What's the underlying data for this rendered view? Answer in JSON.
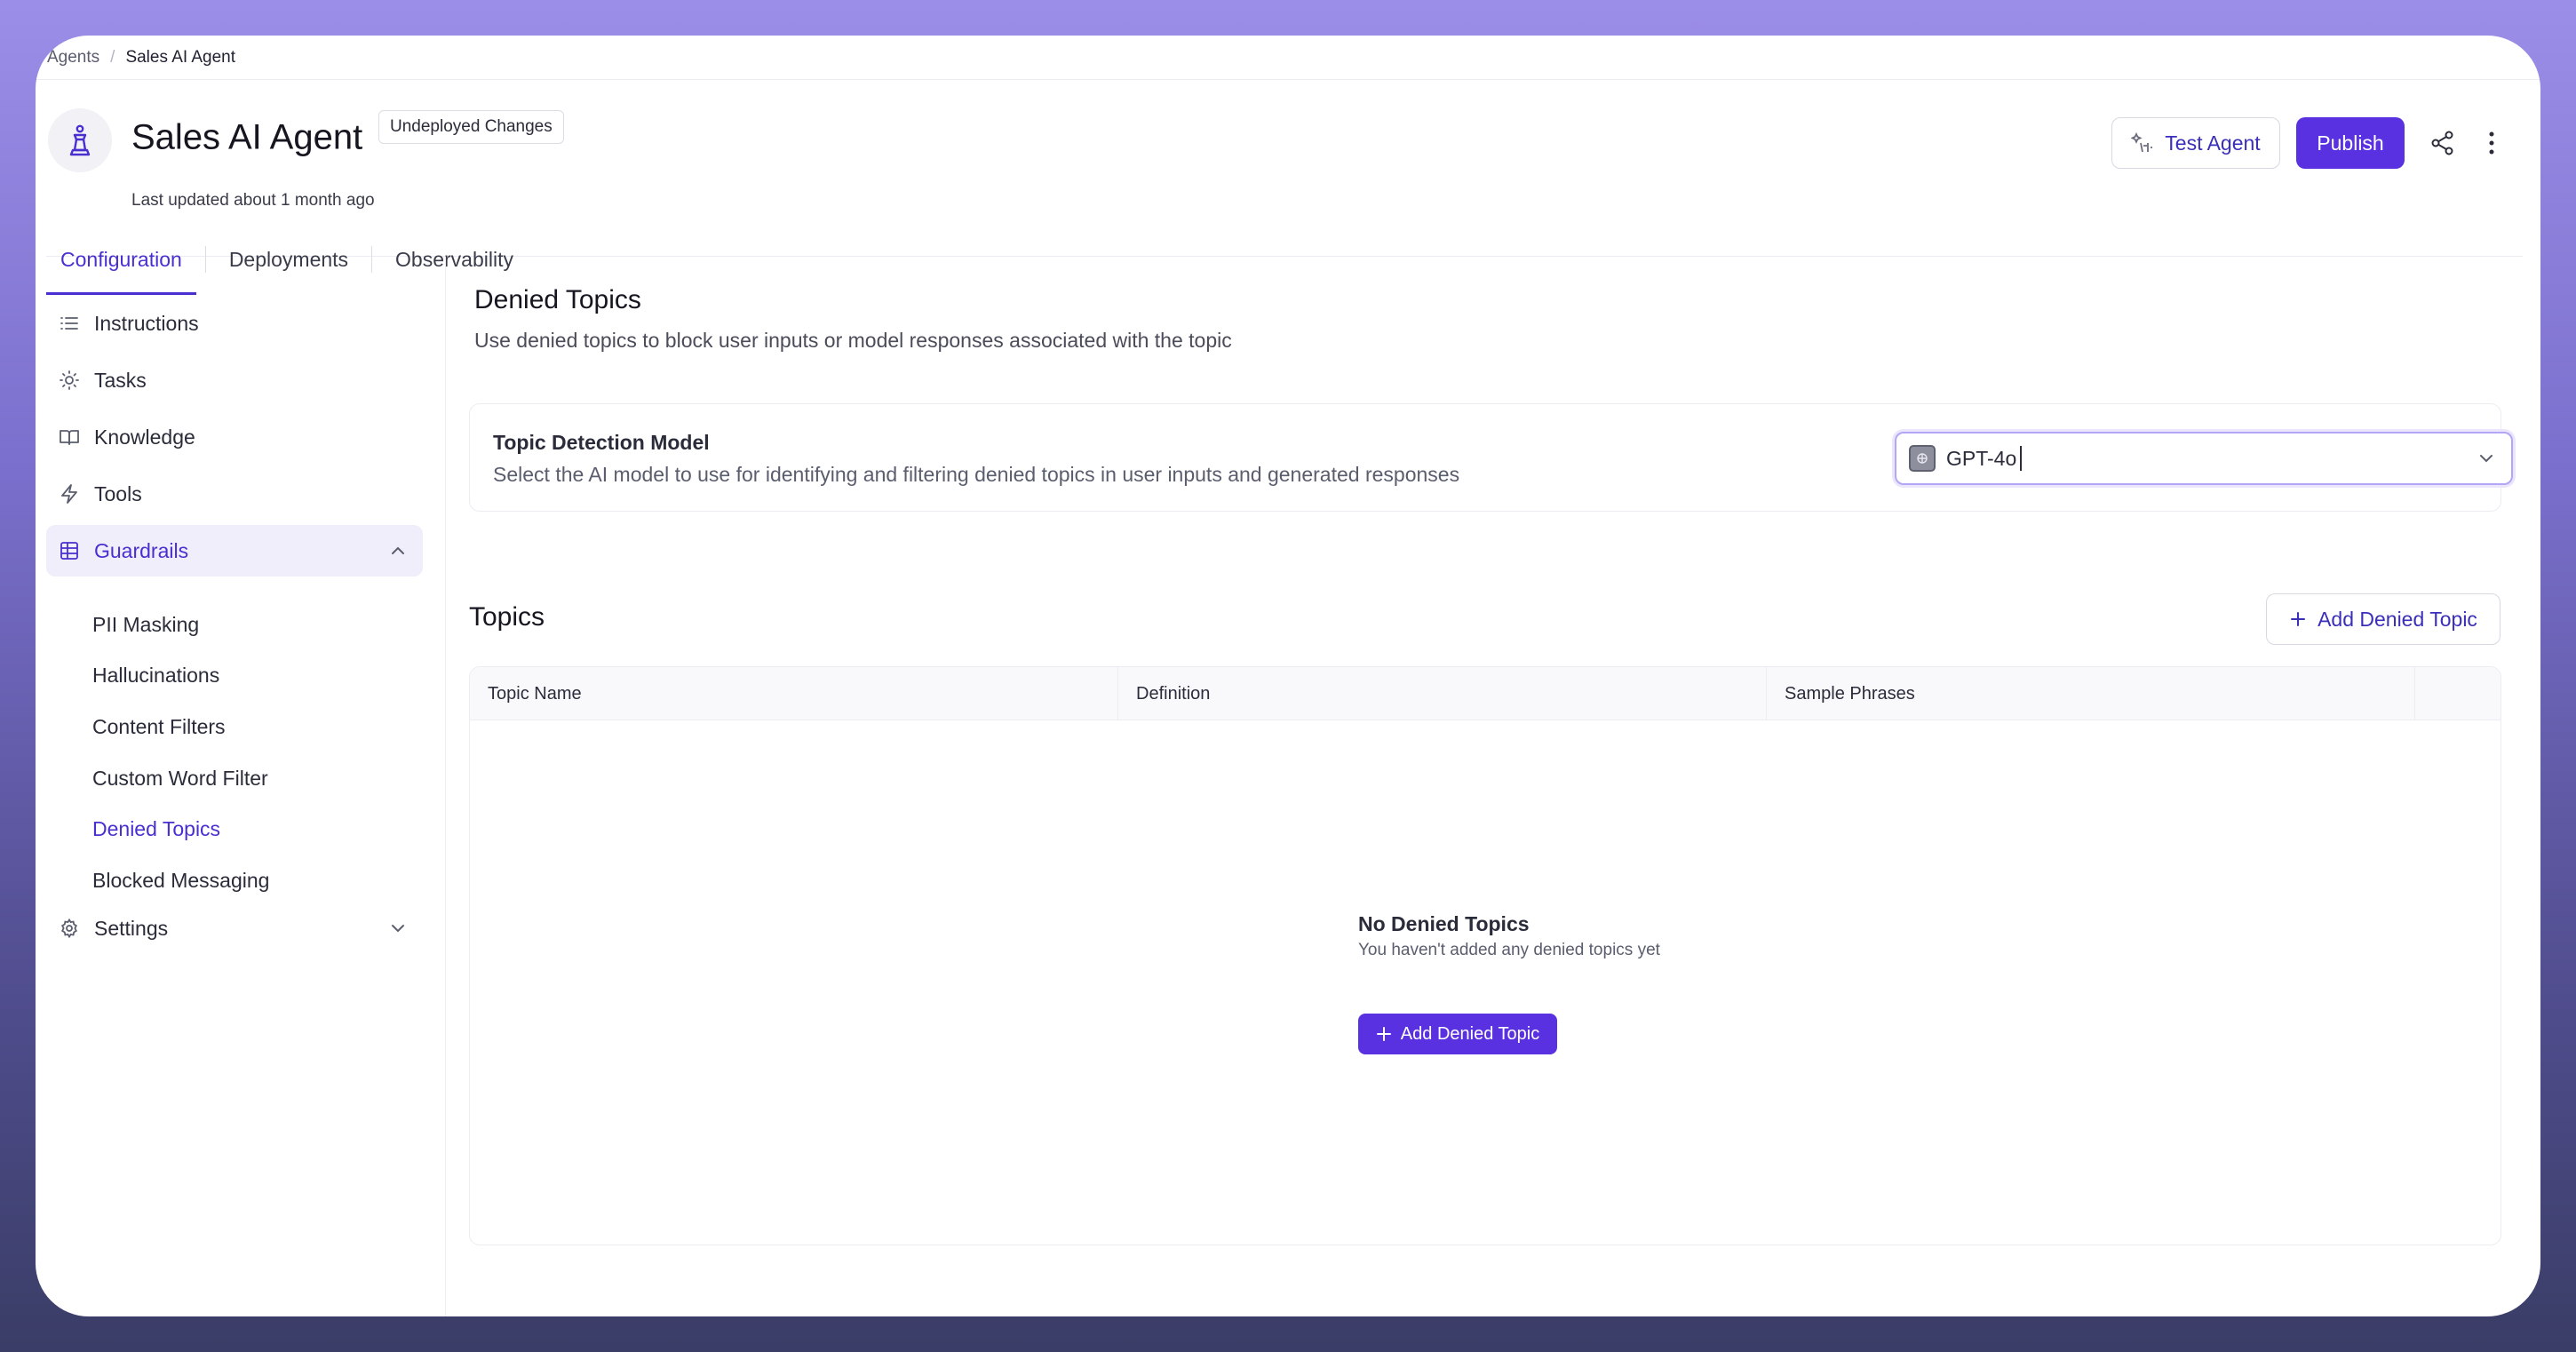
{
  "breadcrumb": {
    "root": "Agents",
    "separator": "/",
    "current": "Sales AI Agent"
  },
  "header": {
    "title": "Sales AI Agent",
    "badge": "Undeployed Changes",
    "updated": "Last updated about 1 month ago",
    "test_label": "Test Agent",
    "publish_label": "Publish"
  },
  "tabs": [
    {
      "label": "Configuration",
      "active": true
    },
    {
      "label": "Deployments"
    },
    {
      "label": "Observability"
    }
  ],
  "sidebar": {
    "items": [
      {
        "label": "Instructions",
        "icon": "list-icon"
      },
      {
        "label": "Tasks",
        "icon": "lightbulb-icon"
      },
      {
        "label": "Knowledge",
        "icon": "book-icon"
      },
      {
        "label": "Tools",
        "icon": "bolt-icon"
      },
      {
        "label": "Guardrails",
        "icon": "table-icon",
        "expanded": true
      },
      {
        "label": "Settings",
        "icon": "gear-icon"
      }
    ],
    "guardrails_sub": [
      "PII Masking",
      "Hallucinations",
      "Content Filters",
      "Custom Word Filter",
      "Denied Topics",
      "Blocked Messaging"
    ],
    "active_sub": "Denied Topics"
  },
  "main": {
    "title": "Denied Topics",
    "description": "Use denied topics to block user inputs or model responses associated with the topic",
    "model_card": {
      "title": "Topic Detection Model",
      "description": "Select the AI model to use for identifying and filtering denied topics in user inputs and generated responses",
      "selected_model": "GPT-4o"
    },
    "topics": {
      "title": "Topics",
      "add_label": "Add Denied Topic",
      "columns": [
        "Topic Name",
        "Definition",
        "Sample Phrases"
      ],
      "empty_title": "No Denied Topics",
      "empty_desc": "You haven't added any denied topics yet",
      "empty_add_label": "Add Denied Topic"
    }
  },
  "colors": {
    "accent": "#5a31e0",
    "accent_text": "#4a2fd0"
  }
}
